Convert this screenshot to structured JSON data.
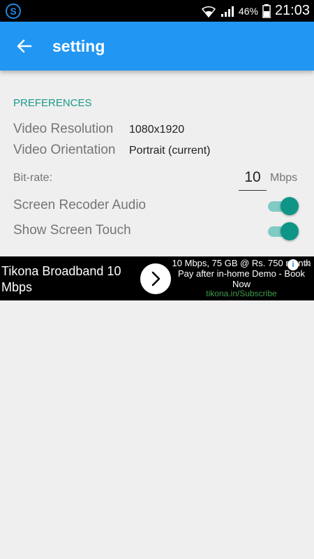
{
  "status_bar": {
    "battery_percent": "46%",
    "time": "21:03"
  },
  "app_bar": {
    "title": "setting"
  },
  "preferences": {
    "section_title": "PREFERENCES",
    "video_resolution_label": "Video Resolution",
    "video_resolution_value": "1080x1920",
    "video_orientation_label": "Video Orientation",
    "video_orientation_value": "Portrait (current)",
    "bitrate_label": "Bit-rate:",
    "bitrate_value": "10",
    "bitrate_unit": "Mbps",
    "audio_label": "Screen Recoder Audio",
    "audio_enabled": true,
    "touch_label": "Show Screen Touch",
    "touch_enabled": true
  },
  "ad": {
    "headline": "Tikona Broadband 10 Mbps",
    "body": "10 Mbps, 75 GB @ Rs. 750 month Pay after in-home Demo - Book Now",
    "url": "tikona.in/Subscribe"
  },
  "colors": {
    "app_bar": "#2196f3",
    "accent": "#0f9585",
    "section_title": "#1a9a8a"
  }
}
